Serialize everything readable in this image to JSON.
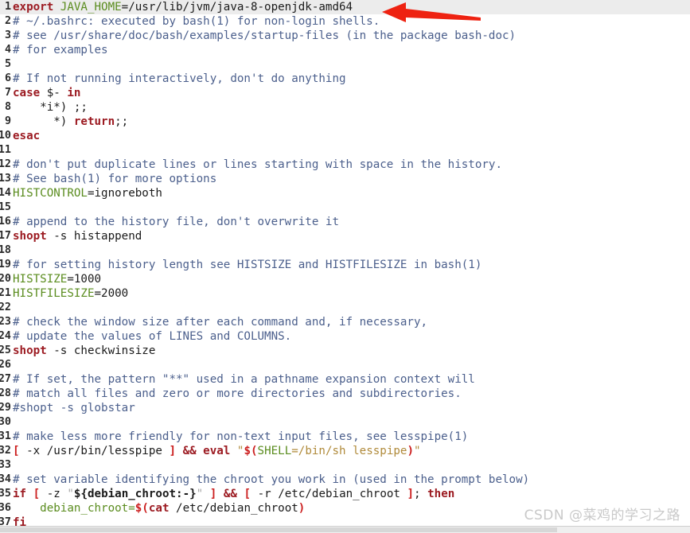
{
  "editor": {
    "file_label": "~/.bashrc",
    "current_line": 1,
    "colors": {
      "background": "#ffffff",
      "current_line_highlight": "#ececec",
      "gutter_text": "#2b2b2b",
      "plain": "#1a1a1a",
      "comment": "#4b5f8c",
      "keyword": "#9c1b22",
      "variable": "#5a8c1e",
      "string": "#b08a3a",
      "substitution": "#cc2020",
      "quote": "#a8a8a8"
    },
    "lines": [
      {
        "number": "1",
        "current": true,
        "tokens": [
          {
            "text": "export ",
            "type": "kw"
          },
          {
            "text": "JAVA_HOME",
            "type": "var"
          },
          {
            "text": "=/usr/lib/jvm/java-8-openjdk-amd64",
            "type": "plain"
          }
        ]
      },
      {
        "number": "2",
        "tokens": [
          {
            "text": "# ~/.bashrc: executed by bash(1) for non-login shells.",
            "type": "comment"
          }
        ]
      },
      {
        "number": "3",
        "tokens": [
          {
            "text": "# see /usr/share/doc/bash/examples/startup-files (in the package bash-doc)",
            "type": "comment"
          }
        ]
      },
      {
        "number": "4",
        "tokens": [
          {
            "text": "# for examples",
            "type": "comment"
          }
        ]
      },
      {
        "number": "5",
        "tokens": [
          {
            "text": "",
            "type": "plain"
          }
        ]
      },
      {
        "number": "6",
        "tokens": [
          {
            "text": "# If not running interactively, don't do anything",
            "type": "comment"
          }
        ]
      },
      {
        "number": "7",
        "tokens": [
          {
            "text": "case ",
            "type": "kw"
          },
          {
            "text": "$- ",
            "type": "plain"
          },
          {
            "text": "in",
            "type": "kw"
          }
        ]
      },
      {
        "number": "8",
        "tokens": [
          {
            "text": "    *i*) ;;",
            "type": "plain"
          }
        ]
      },
      {
        "number": "9",
        "tokens": [
          {
            "text": "      *) ",
            "type": "plain"
          },
          {
            "text": "return",
            "type": "kw"
          },
          {
            "text": ";;",
            "type": "plain"
          }
        ]
      },
      {
        "number": "10",
        "tokens": [
          {
            "text": "esac",
            "type": "kw"
          }
        ]
      },
      {
        "number": "11",
        "tokens": [
          {
            "text": "",
            "type": "plain"
          }
        ]
      },
      {
        "number": "12",
        "tokens": [
          {
            "text": "# don't put duplicate lines or lines starting with space in the history.",
            "type": "comment"
          }
        ]
      },
      {
        "number": "13",
        "tokens": [
          {
            "text": "# See bash(1) for more options",
            "type": "comment"
          }
        ]
      },
      {
        "number": "14",
        "tokens": [
          {
            "text": "HISTCONTROL",
            "type": "var"
          },
          {
            "text": "=ignoreboth",
            "type": "plain"
          }
        ]
      },
      {
        "number": "15",
        "tokens": [
          {
            "text": "",
            "type": "plain"
          }
        ]
      },
      {
        "number": "16",
        "tokens": [
          {
            "text": "# append to the history file, don't overwrite it",
            "type": "comment"
          }
        ]
      },
      {
        "number": "17",
        "tokens": [
          {
            "text": "shopt",
            "type": "kw"
          },
          {
            "text": " -s histappend",
            "type": "plain"
          }
        ]
      },
      {
        "number": "18",
        "tokens": [
          {
            "text": "",
            "type": "plain"
          }
        ]
      },
      {
        "number": "19",
        "tokens": [
          {
            "text": "# for setting history length see HISTSIZE and HISTFILESIZE in bash(1)",
            "type": "comment"
          }
        ]
      },
      {
        "number": "20",
        "tokens": [
          {
            "text": "HISTSIZE",
            "type": "var"
          },
          {
            "text": "=1000",
            "type": "plain"
          }
        ]
      },
      {
        "number": "21",
        "tokens": [
          {
            "text": "HISTFILESIZE",
            "type": "var"
          },
          {
            "text": "=2000",
            "type": "plain"
          }
        ]
      },
      {
        "number": "22",
        "tokens": [
          {
            "text": "",
            "type": "plain"
          }
        ]
      },
      {
        "number": "23",
        "tokens": [
          {
            "text": "# check the window size after each command and, if necessary,",
            "type": "comment"
          }
        ]
      },
      {
        "number": "24",
        "tokens": [
          {
            "text": "# update the values of LINES and COLUMNS.",
            "type": "comment"
          }
        ]
      },
      {
        "number": "25",
        "tokens": [
          {
            "text": "shopt",
            "type": "kw"
          },
          {
            "text": " -s checkwinsize",
            "type": "plain"
          }
        ]
      },
      {
        "number": "26",
        "tokens": [
          {
            "text": "",
            "type": "plain"
          }
        ]
      },
      {
        "number": "27",
        "tokens": [
          {
            "text": "# If set, the pattern \"**\" used in a pathname expansion context will",
            "type": "comment"
          }
        ]
      },
      {
        "number": "28",
        "tokens": [
          {
            "text": "# match all files and zero or more directories and subdirectories.",
            "type": "comment"
          }
        ]
      },
      {
        "number": "29",
        "tokens": [
          {
            "text": "#shopt -s globstar",
            "type": "comment"
          }
        ]
      },
      {
        "number": "30",
        "tokens": [
          {
            "text": "",
            "type": "plain"
          }
        ]
      },
      {
        "number": "31",
        "tokens": [
          {
            "text": "# make less more friendly for non-text input files, see lesspipe(1)",
            "type": "comment"
          }
        ]
      },
      {
        "number": "32",
        "tokens": [
          {
            "text": "[",
            "type": "punct"
          },
          {
            "text": " -x /usr/bin/lesspipe ",
            "type": "plain"
          },
          {
            "text": "]",
            "type": "punct"
          },
          {
            "text": " ",
            "type": "plain"
          },
          {
            "text": "&& eval",
            "type": "kw"
          },
          {
            "text": " ",
            "type": "plain"
          },
          {
            "text": "\"",
            "type": "str"
          },
          {
            "text": "$(",
            "type": "subst"
          },
          {
            "text": "SHELL",
            "type": "var"
          },
          {
            "text": "=/bin/sh lesspipe",
            "type": "str"
          },
          {
            "text": ")",
            "type": "subst"
          },
          {
            "text": "\"",
            "type": "str"
          }
        ]
      },
      {
        "number": "33",
        "tokens": [
          {
            "text": "",
            "type": "plain"
          }
        ]
      },
      {
        "number": "34",
        "tokens": [
          {
            "text": "# set variable identifying the chroot you work in (used in the prompt below)",
            "type": "comment"
          }
        ]
      },
      {
        "number": "35",
        "tokens": [
          {
            "text": "if",
            "type": "kw"
          },
          {
            "text": " ",
            "type": "plain"
          },
          {
            "text": "[",
            "type": "punct"
          },
          {
            "text": " -z ",
            "type": "plain"
          },
          {
            "text": "\"",
            "type": "quote"
          },
          {
            "text": "${debian_chroot:-}",
            "type": "bold"
          },
          {
            "text": "\"",
            "type": "quote"
          },
          {
            "text": " ",
            "type": "plain"
          },
          {
            "text": "]",
            "type": "punct"
          },
          {
            "text": " ",
            "type": "plain"
          },
          {
            "text": "&&",
            "type": "kw"
          },
          {
            "text": " ",
            "type": "plain"
          },
          {
            "text": "[",
            "type": "punct"
          },
          {
            "text": " -r /etc/debian_chroot ",
            "type": "plain"
          },
          {
            "text": "]",
            "type": "punct"
          },
          {
            "text": "; ",
            "type": "plain"
          },
          {
            "text": "then",
            "type": "kw"
          }
        ]
      },
      {
        "number": "36",
        "tokens": [
          {
            "text": "    ",
            "type": "plain"
          },
          {
            "text": "debian_chroot=",
            "type": "var"
          },
          {
            "text": "$(",
            "type": "subst"
          },
          {
            "text": "cat",
            "type": "kw"
          },
          {
            "text": " /etc/debian_chroot",
            "type": "plain"
          },
          {
            "text": ")",
            "type": "subst"
          }
        ]
      },
      {
        "number": "37",
        "tokens": [
          {
            "text": "fi",
            "type": "kw"
          }
        ]
      }
    ]
  },
  "annotation": {
    "arrow_label": "red-pointer-arrow",
    "arrow_color": "#ee2211",
    "points_to_line": "1"
  },
  "watermark": {
    "text": "CSDN @菜鸡的学习之路"
  }
}
